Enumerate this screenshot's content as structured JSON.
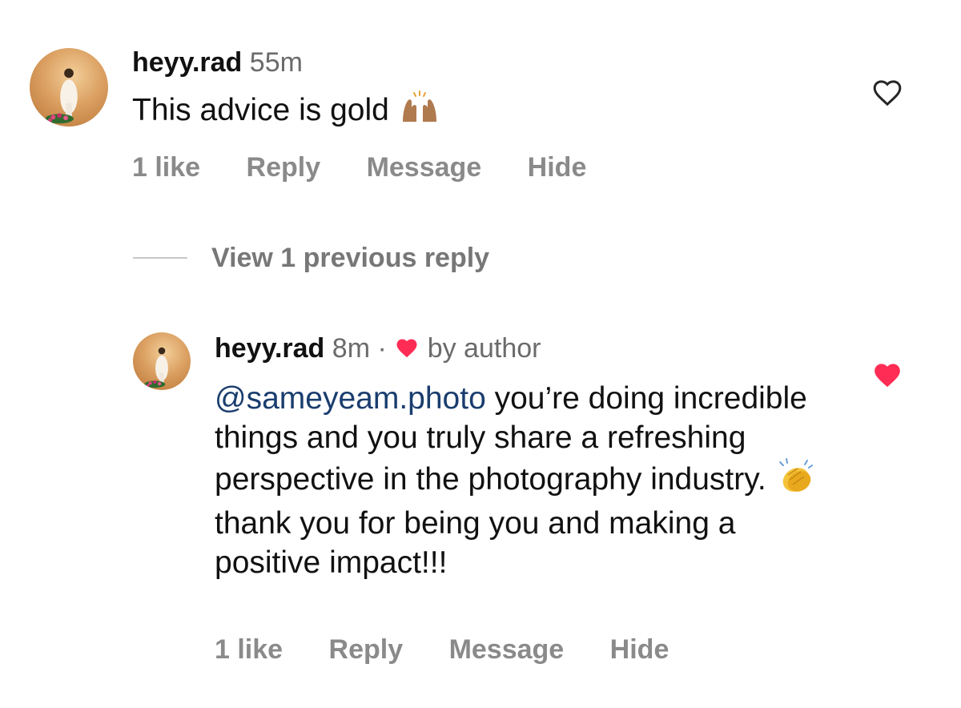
{
  "comments": [
    {
      "username": "heyy.rad",
      "time": "55m",
      "text": "This advice is gold",
      "text_emoji": "raising-hands-emoji",
      "actions": {
        "likes": "1 like",
        "reply": "Reply",
        "message": "Message",
        "hide": "Hide"
      },
      "liked": false
    }
  ],
  "view_replies": "View 1 previous reply",
  "reply": {
    "username": "heyy.rad",
    "time": "8m",
    "separator": "·",
    "author_label": "by author",
    "mention": "@sameyeam.photo",
    "text_part1": " you’re doing incredible things and you truly share a refreshing perspective in the photography industry. ",
    "text_emoji": "clapping-hands-emoji",
    "text_part2": " thank you for being you and making a positive impact!!!",
    "actions": {
      "likes": "1 like",
      "reply": "Reply",
      "message": "Message",
      "hide": "Hide"
    },
    "liked": true
  },
  "colors": {
    "heart_red": "#ff2d55",
    "mention_blue": "#1a3d6e",
    "secondary_gray": "#8a8a8a"
  }
}
